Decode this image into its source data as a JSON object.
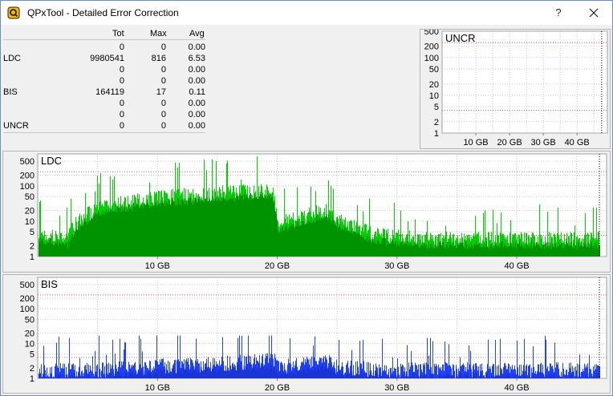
{
  "window": {
    "title": "QPxTool - Detailed Error Correction",
    "help_label": "?"
  },
  "summary": {
    "headers": {
      "tot": "Tot",
      "max": "Max",
      "avg": "Avg"
    },
    "rows": [
      {
        "label": "",
        "tot": "0",
        "max": "0",
        "avg": "0.00"
      },
      {
        "label": "LDC",
        "tot": "9980541",
        "max": "816",
        "avg": "6.53"
      },
      {
        "label": "",
        "tot": "0",
        "max": "0",
        "avg": "0.00"
      },
      {
        "label": "",
        "tot": "0",
        "max": "0",
        "avg": "0.00"
      },
      {
        "label": "BIS",
        "tot": "164119",
        "max": "17",
        "avg": "0.11"
      },
      {
        "label": "",
        "tot": "0",
        "max": "0",
        "avg": "0.00"
      },
      {
        "label": "",
        "tot": "0",
        "max": "0",
        "avg": "0.00"
      },
      {
        "label": "UNCR",
        "tot": "0",
        "max": "0",
        "avg": "0.00"
      }
    ]
  },
  "chart_data": [
    {
      "type": "bar",
      "title": "UNCR",
      "y_scale": "log",
      "ylim": [
        1,
        500
      ],
      "y_ticks": [
        "500",
        "200",
        "100",
        "50",
        "20",
        "10",
        "5",
        "2",
        "1"
      ],
      "x_ticks": [
        "10 GB",
        "20 GB",
        "30 GB",
        "40 GB"
      ],
      "xlim_gb": [
        0,
        49
      ],
      "grid": true,
      "data_end_gb": 47.3,
      "values": "all zero",
      "bar_color": "#ff0000"
    },
    {
      "type": "bar",
      "title": "LDC",
      "y_scale": "log",
      "ylim": [
        1,
        800
      ],
      "y_ticks": [
        "500",
        "200",
        "100",
        "50",
        "20",
        "10",
        "5",
        "2",
        "1"
      ],
      "x_ticks": [
        "10 GB",
        "20 GB",
        "30 GB",
        "40 GB"
      ],
      "xlim_gb": [
        0,
        47.5
      ],
      "grid": true,
      "data_end_gb": 46.9,
      "max_value": 816,
      "bar_color": "#00d000",
      "avg_color": "#006000",
      "profile": [
        {
          "gb": 0.0,
          "level": 4
        },
        {
          "gb": 2.5,
          "level": 3
        },
        {
          "gb": 5.5,
          "level": 25
        },
        {
          "gb": 10.0,
          "level": 45
        },
        {
          "gb": 15.0,
          "level": 60
        },
        {
          "gb": 19.5,
          "level": 75
        },
        {
          "gb": 20.0,
          "level": 8
        },
        {
          "gb": 22.0,
          "level": 12
        },
        {
          "gb": 24.0,
          "level": 20
        },
        {
          "gb": 25.5,
          "level": 8
        },
        {
          "gb": 28.0,
          "level": 4
        },
        {
          "gb": 32.0,
          "level": 3
        },
        {
          "gb": 40.0,
          "level": 3
        },
        {
          "gb": 46.9,
          "level": 3
        }
      ]
    },
    {
      "type": "bar",
      "title": "BIS",
      "y_scale": "log",
      "ylim": [
        1,
        800
      ],
      "y_ticks": [
        "500",
        "200",
        "100",
        "50",
        "20",
        "10",
        "5",
        "2",
        "1"
      ],
      "x_ticks": [
        "10 GB",
        "20 GB",
        "30 GB",
        "40 GB"
      ],
      "xlim_gb": [
        0,
        47.5
      ],
      "grid": true,
      "data_end_gb": 46.9,
      "max_value": 17,
      "bar_color": "#2040ff",
      "dark_color": "#10208a",
      "profile": [
        {
          "gb": 0.0,
          "level": 1.6
        },
        {
          "gb": 5.0,
          "level": 1.7
        },
        {
          "gb": 10.0,
          "level": 2.2
        },
        {
          "gb": 15.0,
          "level": 2.6
        },
        {
          "gb": 19.5,
          "level": 3.2
        },
        {
          "gb": 20.0,
          "level": 2.0
        },
        {
          "gb": 23.0,
          "level": 2.6
        },
        {
          "gb": 24.0,
          "level": 3.2
        },
        {
          "gb": 25.0,
          "level": 2.0
        },
        {
          "gb": 30.0,
          "level": 1.7
        },
        {
          "gb": 40.0,
          "level": 1.7
        },
        {
          "gb": 46.9,
          "level": 1.7
        }
      ]
    }
  ]
}
